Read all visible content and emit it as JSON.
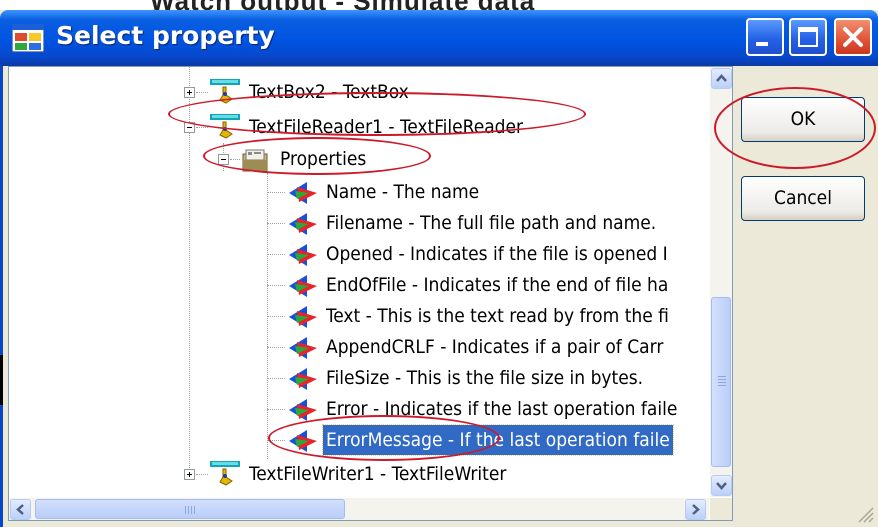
{
  "background": {
    "partial_text": "Watch output - Simulate data"
  },
  "window": {
    "title": "Select property",
    "controls": {
      "minimize": "minimize-icon",
      "maximize": "maximize-icon",
      "close": "close-icon"
    }
  },
  "tree": {
    "nodes": [
      {
        "label": "TextBox2 - TextBox",
        "icon": "component-icon",
        "expanded": false
      },
      {
        "label": "TextFileReader1 - TextFileReader",
        "icon": "component-icon",
        "expanded": true
      },
      {
        "label": "Properties",
        "icon": "properties-folder-icon",
        "expanded": true
      },
      {
        "label": "Name - The name",
        "icon": "property-icon"
      },
      {
        "label": "Filename - The full file path and name.",
        "icon": "property-icon"
      },
      {
        "label": "Opened - Indicates if the file is opened I",
        "icon": "property-icon"
      },
      {
        "label": "EndOfFile - Indicates if the end of file ha",
        "icon": "property-icon"
      },
      {
        "label": "Text - This is the text read by from the fi",
        "icon": "property-icon"
      },
      {
        "label": "AppendCRLF - Indicates if a pair of Carr",
        "icon": "property-icon"
      },
      {
        "label": "FileSize - This is the file size in bytes.",
        "icon": "property-icon"
      },
      {
        "label": "Error - Indicates if the last operation faile",
        "icon": "property-icon"
      },
      {
        "label": "ErrorMessage - If the last operation faile",
        "icon": "property-icon",
        "selected": true
      },
      {
        "label": "TextFileWriter1 - TextFileWriter",
        "icon": "component-icon",
        "expanded": false
      }
    ]
  },
  "buttons": {
    "ok": "OK",
    "cancel": "Cancel"
  },
  "colors": {
    "titlebar": "#0054e3",
    "selection": "#316ac5",
    "annotation": "#cc1a2a",
    "dialog_face": "#ece9d8"
  }
}
